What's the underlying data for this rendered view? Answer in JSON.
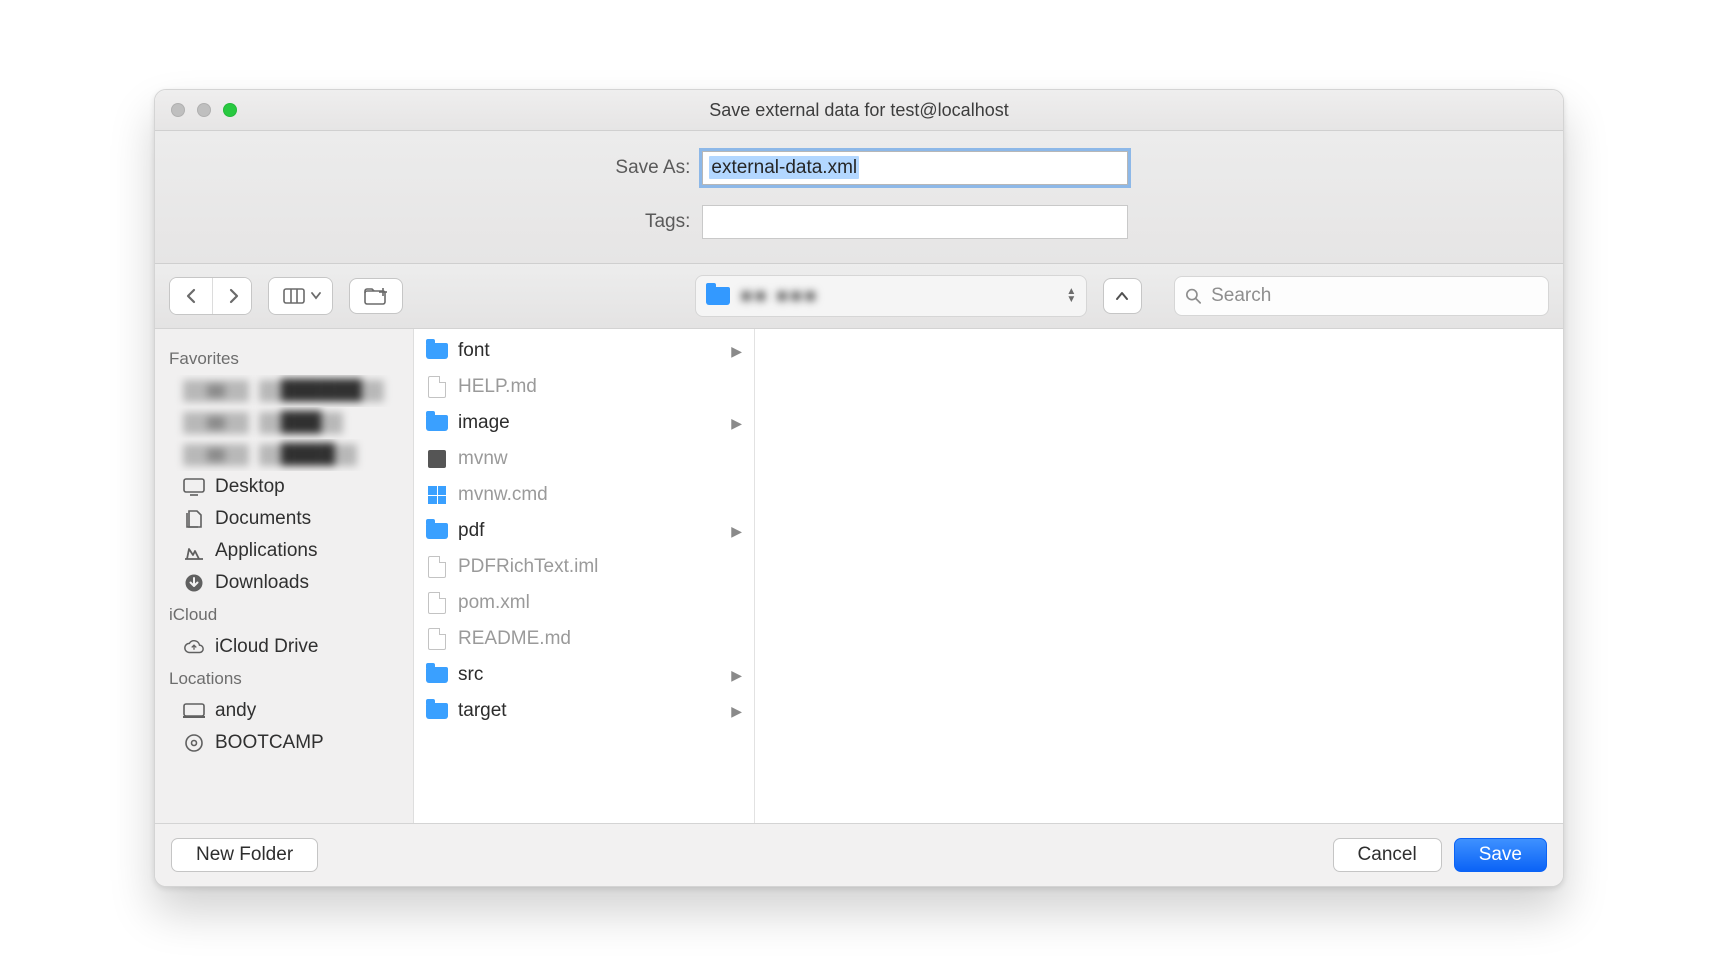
{
  "window": {
    "title": "Save external data for test@localhost"
  },
  "form": {
    "save_as_label": "Save As:",
    "save_as_value": "external-data.xml",
    "tags_label": "Tags:",
    "tags_value": ""
  },
  "toolbar": {
    "path_text": "■■  ■■■",
    "search_placeholder": "Search"
  },
  "sidebar": {
    "sections": [
      {
        "heading": "Favorites",
        "items": [
          {
            "label": "██████",
            "icon": "blur",
            "blurred": true
          },
          {
            "label": "███",
            "icon": "blur",
            "blurred": true
          },
          {
            "label": "████",
            "icon": "blur",
            "blurred": true
          },
          {
            "label": "Desktop",
            "icon": "desktop"
          },
          {
            "label": "Documents",
            "icon": "documents"
          },
          {
            "label": "Applications",
            "icon": "applications"
          },
          {
            "label": "Downloads",
            "icon": "downloads"
          }
        ]
      },
      {
        "heading": "iCloud",
        "items": [
          {
            "label": "iCloud Drive",
            "icon": "cloud"
          }
        ]
      },
      {
        "heading": "Locations",
        "items": [
          {
            "label": "andy",
            "icon": "computer"
          },
          {
            "label": "BOOTCAMP",
            "icon": "disk"
          }
        ]
      }
    ]
  },
  "files": [
    {
      "name": "font",
      "type": "folder",
      "dim": false
    },
    {
      "name": "HELP.md",
      "type": "file",
      "dim": true
    },
    {
      "name": "image",
      "type": "folder",
      "dim": false
    },
    {
      "name": "mvnw",
      "type": "exec",
      "dim": true
    },
    {
      "name": "mvnw.cmd",
      "type": "win",
      "dim": true
    },
    {
      "name": "pdf",
      "type": "folder",
      "dim": false
    },
    {
      "name": "PDFRichText.iml",
      "type": "file",
      "dim": true
    },
    {
      "name": "pom.xml",
      "type": "file",
      "dim": true
    },
    {
      "name": "README.md",
      "type": "file",
      "dim": true
    },
    {
      "name": "src",
      "type": "folder",
      "dim": false
    },
    {
      "name": "target",
      "type": "folder",
      "dim": false
    }
  ],
  "footer": {
    "new_folder": "New Folder",
    "cancel": "Cancel",
    "save": "Save"
  }
}
